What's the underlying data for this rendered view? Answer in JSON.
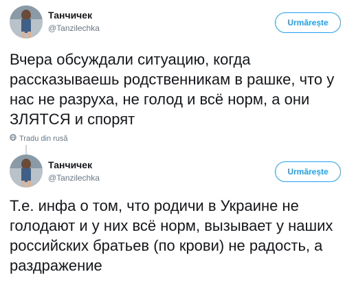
{
  "tweets": [
    {
      "author_name": "Танчичек",
      "author_handle": "@Tanzilechka",
      "follow_label": "Urmărește",
      "text": "Вчера обсуждали ситуацию, когда рассказываешь родственникам в рашке, что у нас не разруха, не голод и всё норм, а они ЗЛЯТСЯ и спорят",
      "translate_label": "Tradu din rusă"
    },
    {
      "author_name": "Танчичек",
      "author_handle": "@Tanzilechka",
      "follow_label": "Urmărește",
      "text": "Т.е. инфа о том, что родичи в Украине не голодают и у них всё норм, вызывает у наших российских братьев (по крови) не радость, а раздражение"
    }
  ],
  "colors": {
    "accent": "#1da1f2",
    "secondary_text": "#657786",
    "thread_line": "#ccd6dd"
  },
  "icons": {
    "translate": "globe-icon"
  }
}
